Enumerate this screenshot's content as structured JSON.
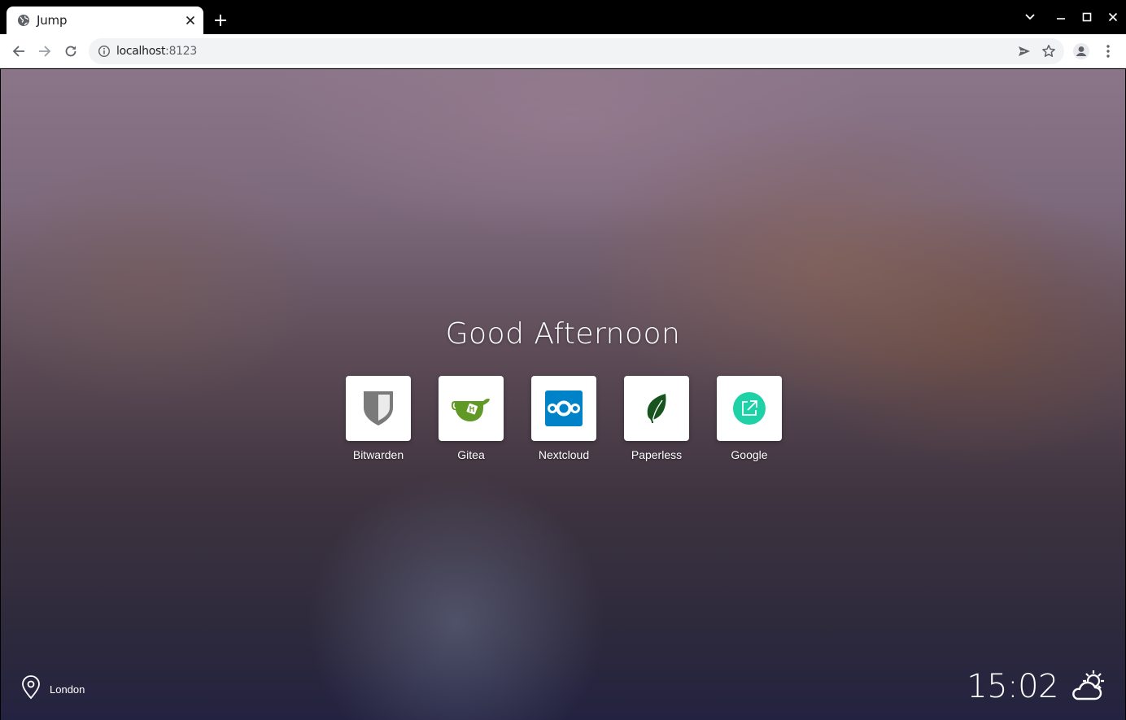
{
  "browser": {
    "tab_title": "Jump",
    "url_host": "localhost",
    "url_port": ":8123"
  },
  "page": {
    "greeting": "Good Afternoon",
    "sites": [
      {
        "name": "Bitwarden",
        "icon": "bitwarden-shield-icon"
      },
      {
        "name": "Gitea",
        "icon": "gitea-teacup-icon"
      },
      {
        "name": "Nextcloud",
        "icon": "nextcloud-icon"
      },
      {
        "name": "Paperless",
        "icon": "paperless-leaf-icon"
      },
      {
        "name": "Google",
        "icon": "external-link-icon"
      }
    ],
    "location": "London",
    "time": "15:02",
    "weather_icon": "partly-cloudy-day-icon"
  },
  "colors": {
    "nextcloud": "#0082c9",
    "gitea": "#609926",
    "paperless": "#17541f",
    "google_link": "#1fd1a7",
    "bitwarden": "#7a7a7a"
  }
}
